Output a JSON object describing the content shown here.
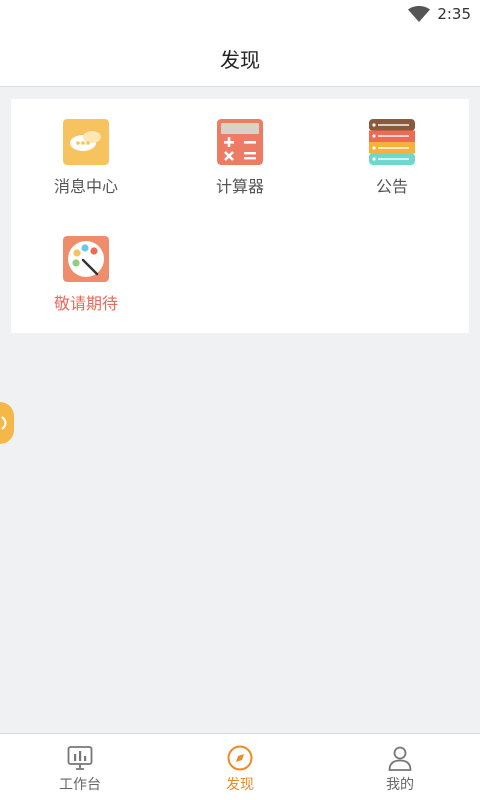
{
  "status": {
    "time": "2:35",
    "wifi_icon": "wifi-icon"
  },
  "header": {
    "title": "发现"
  },
  "grid": [
    {
      "label": "消息中心",
      "icon": "chat-bubble-icon"
    },
    {
      "label": "计算器",
      "icon": "calculator-icon"
    },
    {
      "label": "公告",
      "icon": "list-icon"
    },
    {
      "label": "敬请期待",
      "icon": "palette-icon"
    }
  ],
  "floating_button": {
    "icon": "speaker-icon"
  },
  "tabs": [
    {
      "label": "工作台",
      "icon": "chart-board-icon",
      "active": false
    },
    {
      "label": "发现",
      "icon": "compass-icon",
      "active": true
    },
    {
      "label": "我的",
      "icon": "person-icon",
      "active": false
    }
  ],
  "colors": {
    "accent": "#f08a24",
    "soon_text": "#e86a5a",
    "background": "#f0f1f3"
  }
}
